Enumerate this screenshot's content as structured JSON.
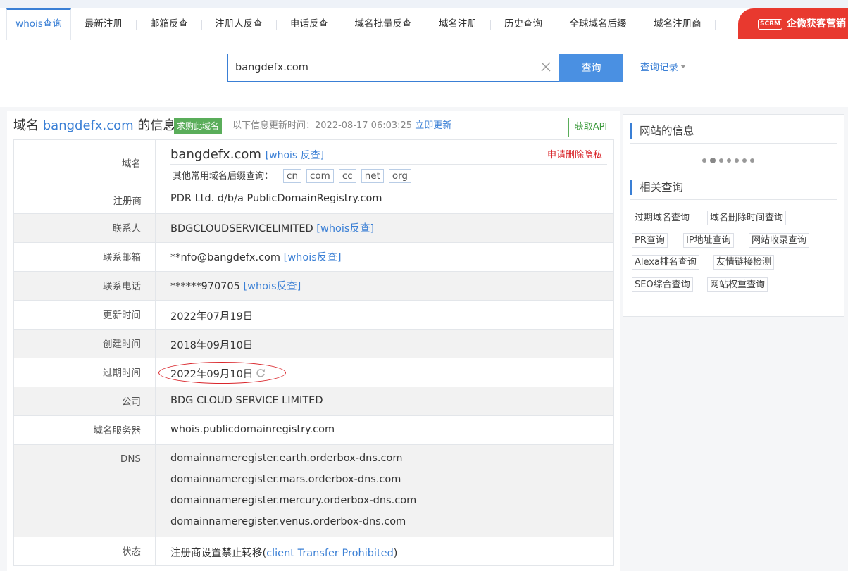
{
  "nav": {
    "tabs": [
      "whois查询",
      "最新注册",
      "邮箱反查",
      "注册人反查",
      "电话反查",
      "域名批量反查",
      "域名注册",
      "历史查询",
      "全球域名后缀",
      "域名注册商"
    ],
    "ad_badge": "SCRM",
    "ad_text": "企微获客营销"
  },
  "search": {
    "value": "bangdefx.com",
    "button": "查询",
    "history": "查询记录"
  },
  "header": {
    "prefix": "域名",
    "domain": "bangdefx.com",
    "suffix": "的信息",
    "buy_badge": "求购此域名",
    "update_label": "以下信息更新时间：2022-08-17 06:03:25",
    "update_link": "立即更新",
    "api_button": "获取API"
  },
  "record": {
    "domain_label": "域名",
    "domain_value": "bangdefx.com",
    "whois_reverse_spaced": "[whois 反查]",
    "privacy_link": "申请删除隐私",
    "suffix_label": "其他常用域名后缀查询：",
    "suffixes": [
      "cn",
      "com",
      "cc",
      "net",
      "org"
    ],
    "registrar_label": "注册商",
    "registrar_value": "PDR Ltd. d/b/a PublicDomainRegistry.com",
    "contact_label": "联系人",
    "contact_value": "BDGCLOUDSERVICELIMITED",
    "whois_reverse": "[whois反查]",
    "email_label": "联系邮箱",
    "email_value": "**nfo@bangdefx.com",
    "phone_label": "联系电话",
    "phone_value": "******970705",
    "updated_label": "更新时间",
    "updated_value": "2022年07月19日",
    "created_label": "创建时间",
    "created_value": "2018年09月10日",
    "expires_label": "过期时间",
    "expires_value": "2022年09月10日",
    "company_label": "公司",
    "company_value": "BDG CLOUD SERVICE LIMITED",
    "server_label": "域名服务器",
    "server_value": "whois.publicdomainregistry.com",
    "dns_label": "DNS",
    "dns": [
      "domainnameregister.earth.orderbox-dns.com",
      "domainnameregister.mars.orderbox-dns.com",
      "domainnameregister.mercury.orderbox-dns.com",
      "domainnameregister.venus.orderbox-dns.com"
    ],
    "status_label": "状态",
    "status_prefix": "注册商设置禁止转移(",
    "status_link": "client Transfer Prohibited",
    "status_suffix": ")"
  },
  "side": {
    "site_info_title": "网站的信息",
    "related_title": "相关查询",
    "related": [
      "过期域名查询",
      "域名删除时间查询",
      "PR查询",
      "IP地址查询",
      "网站收录查询",
      "Alexa排名查询",
      "友情链接检测",
      "SEO综合查询",
      "网站权重查询"
    ]
  },
  "colors": {
    "accent": "#3a7fd5",
    "button": "#4a90e2",
    "green": "#5aad5a",
    "red": "#d9262b"
  }
}
